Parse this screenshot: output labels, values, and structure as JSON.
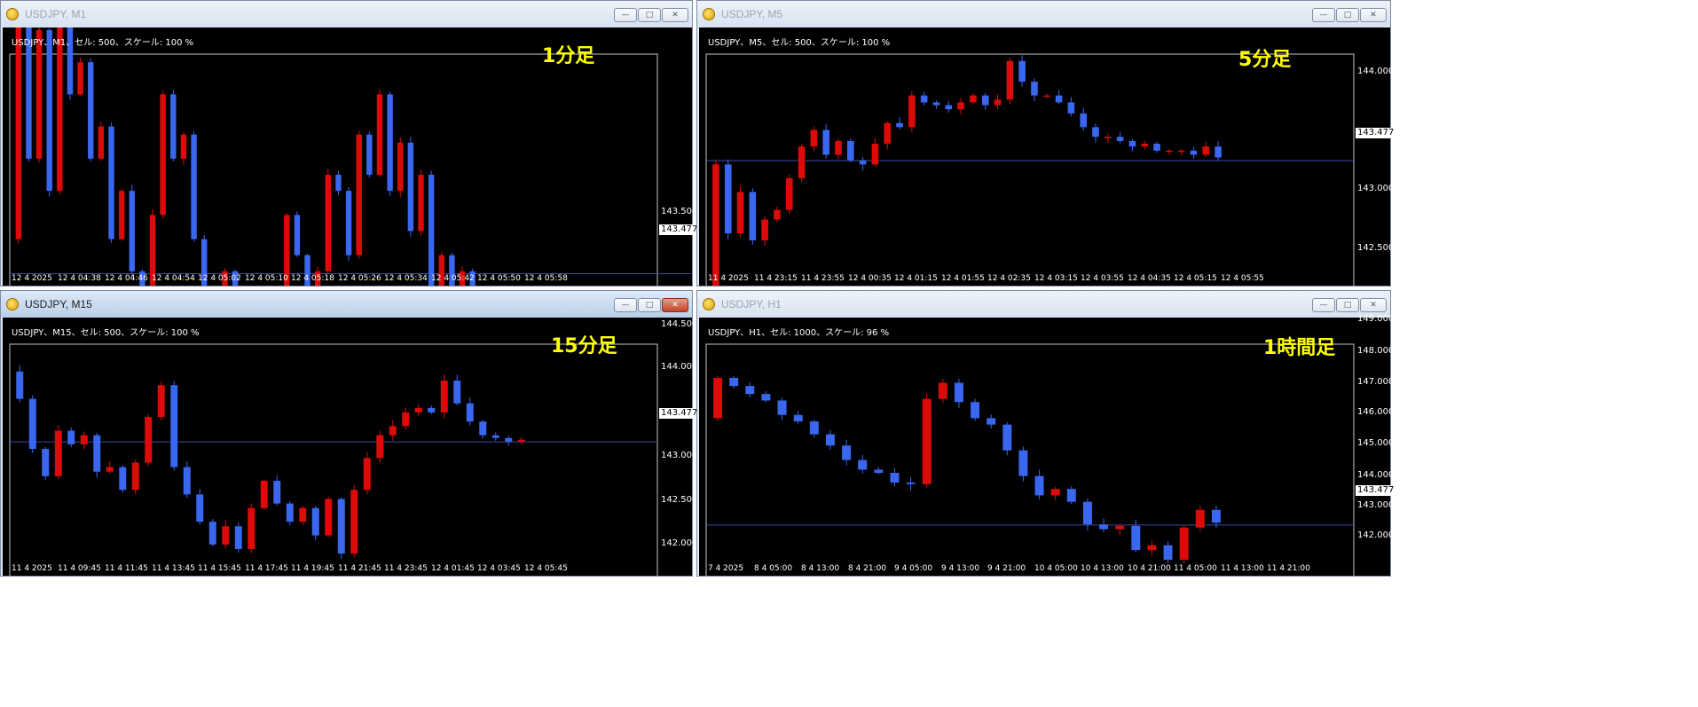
{
  "colors": {
    "bull": "#dd0a0a",
    "bear": "#3a67f0",
    "price_line": "#3c4aa6",
    "background": "#000000",
    "label": "#ffff00"
  },
  "windows": [
    {
      "title": "USDJPY, M1",
      "active": false,
      "header": "USDJPY、M1、セル: 500、スケール: 100 %",
      "label": "1分足",
      "buttons": {
        "minimize": "—",
        "maximize": "□",
        "close": "✕"
      },
      "price_box": "143.477",
      "y_ticks": [
        "143.500"
      ],
      "x_ticks": [
        "12 4 2025",
        "12 4 04:38",
        "12 4 04:46",
        "12 4 04:54",
        "12 4 05:02",
        "12 4 05:10",
        "12 4 05:18",
        "12 4 05:26",
        "12 4 05:34",
        "12 4 05:42",
        "12 4 05:50",
        "12 4 05:58"
      ],
      "chart_data": {
        "type": "candlestick",
        "current_price": 143.477,
        "y_range": [
          143.45,
          143.75
        ],
        "path": [
          143.52,
          143.85,
          143.62,
          143.78,
          143.58,
          143.8,
          143.7,
          143.74,
          143.62,
          143.66,
          143.52,
          143.58,
          143.48,
          143.44,
          143.55,
          143.7,
          143.62,
          143.65,
          143.52,
          143.46,
          143.42,
          143.48,
          143.4,
          143.45,
          143.36,
          143.42,
          143.38,
          143.55,
          143.5,
          143.4,
          143.48,
          143.6,
          143.58,
          143.5,
          143.65,
          143.6,
          143.7,
          143.58,
          143.64,
          143.53,
          143.6,
          143.45,
          143.5,
          143.38,
          143.48,
          143.3,
          143.4,
          143.22,
          143.3,
          143.36
        ]
      }
    },
    {
      "title": "USDJPY, M5",
      "active": false,
      "header": "USDJPY、M5、セル: 500、スケール: 100 %",
      "label": "5分足",
      "buttons": {
        "minimize": "—",
        "maximize": "□",
        "close": "✕"
      },
      "price_box": "143.477",
      "y_ticks": [
        "144.000",
        "143.000",
        "142.500"
      ],
      "x_ticks": [
        "11 4 2025",
        "11 4 23:15",
        "11 4 23:55",
        "12 4 00:35",
        "12 4 01:15",
        "12 4 01:55",
        "12 4 02:35",
        "12 4 03:15",
        "12 4 03:55",
        "12 4 04:35",
        "12 4 05:15",
        "12 4 05:55"
      ],
      "chart_data": {
        "type": "candlestick",
        "current_price": 143.477,
        "y_range": [
          142.5,
          144.25
        ],
        "path": [
          142.55,
          143.45,
          142.95,
          143.25,
          142.9,
          143.05,
          143.12,
          143.35,
          143.58,
          143.7,
          143.52,
          143.62,
          143.48,
          143.45,
          143.6,
          143.75,
          143.72,
          143.95,
          143.9,
          143.88,
          143.85,
          143.9,
          143.95,
          143.88,
          143.92,
          144.2,
          144.05,
          143.95,
          143.95,
          143.9,
          143.82,
          143.72,
          143.65,
          143.65,
          143.62,
          143.58,
          143.6,
          143.55,
          143.55,
          143.55,
          143.52,
          143.58,
          143.5
        ]
      }
    },
    {
      "title": "USDJPY, M15",
      "active": true,
      "header": "USDJPY、M15、セル: 500、スケール: 100 %",
      "label": "15分足",
      "buttons": {
        "minimize": "—",
        "maximize": "□",
        "close": "✕"
      },
      "price_box": "143.477",
      "y_ticks": [
        "144.500",
        "144.000",
        "143.000",
        "142.500",
        "142.000"
      ],
      "x_ticks": [
        "11 4 2025",
        "11 4 09:45",
        "11 4 11:45",
        "11 4 13:45",
        "11 4 15:45",
        "11 4 17:45",
        "11 4 19:45",
        "11 4 21:45",
        "11 4 23:45",
        "12 4 01:45",
        "12 4 03:45",
        "12 4 05:45"
      ],
      "chart_data": {
        "type": "candlestick",
        "current_price": 143.477,
        "y_range": [
          141.9,
          144.55
        ],
        "path": [
          144.25,
          143.95,
          143.4,
          143.1,
          143.6,
          143.45,
          143.55,
          143.15,
          143.2,
          142.95,
          143.25,
          143.75,
          144.1,
          143.2,
          142.9,
          142.6,
          142.35,
          142.55,
          142.3,
          142.75,
          143.05,
          142.8,
          142.6,
          142.75,
          142.45,
          142.85,
          142.25,
          142.95,
          143.3,
          143.55,
          143.65,
          143.8,
          143.85,
          143.8,
          144.15,
          143.9,
          143.7,
          143.55,
          143.52,
          143.48,
          143.5
        ]
      }
    },
    {
      "title": "USDJPY, H1",
      "active": false,
      "header": "USDJPY、H1、セル: 1000、スケール: 96 %",
      "label": "1時間足",
      "buttons": {
        "minimize": "—",
        "maximize": "□",
        "close": "✕"
      },
      "price_box": "143.477",
      "y_ticks": [
        "149.000",
        "148.000",
        "147.000",
        "146.000",
        "145.000",
        "144.000",
        "143.000",
        "142.000"
      ],
      "x_ticks": [
        "7 4 2025",
        "8 4 05:00",
        "8 4 13:00",
        "8 4 21:00",
        "9 4 05:00",
        "9 4 13:00",
        "9 4 21:00",
        "10 4 05:00",
        "10 4 13:00",
        "10 4 21:00",
        "11 4 05:00",
        "11 4 13:00",
        "11 4 21:00"
      ],
      "chart_data": {
        "type": "candlestick",
        "current_price": 143.477,
        "y_range": [
          141.6,
          149.1
        ],
        "path": [
          146.8,
          148.05,
          147.8,
          147.55,
          147.35,
          146.9,
          146.7,
          146.3,
          145.95,
          145.5,
          145.2,
          145.1,
          144.8,
          144.75,
          147.4,
          147.9,
          147.3,
          146.8,
          146.6,
          145.8,
          145.0,
          144.4,
          144.6,
          144.2,
          143.5,
          143.35,
          143.45,
          142.7,
          142.85,
          142.4,
          143.4,
          143.95,
          143.55
        ]
      }
    }
  ]
}
